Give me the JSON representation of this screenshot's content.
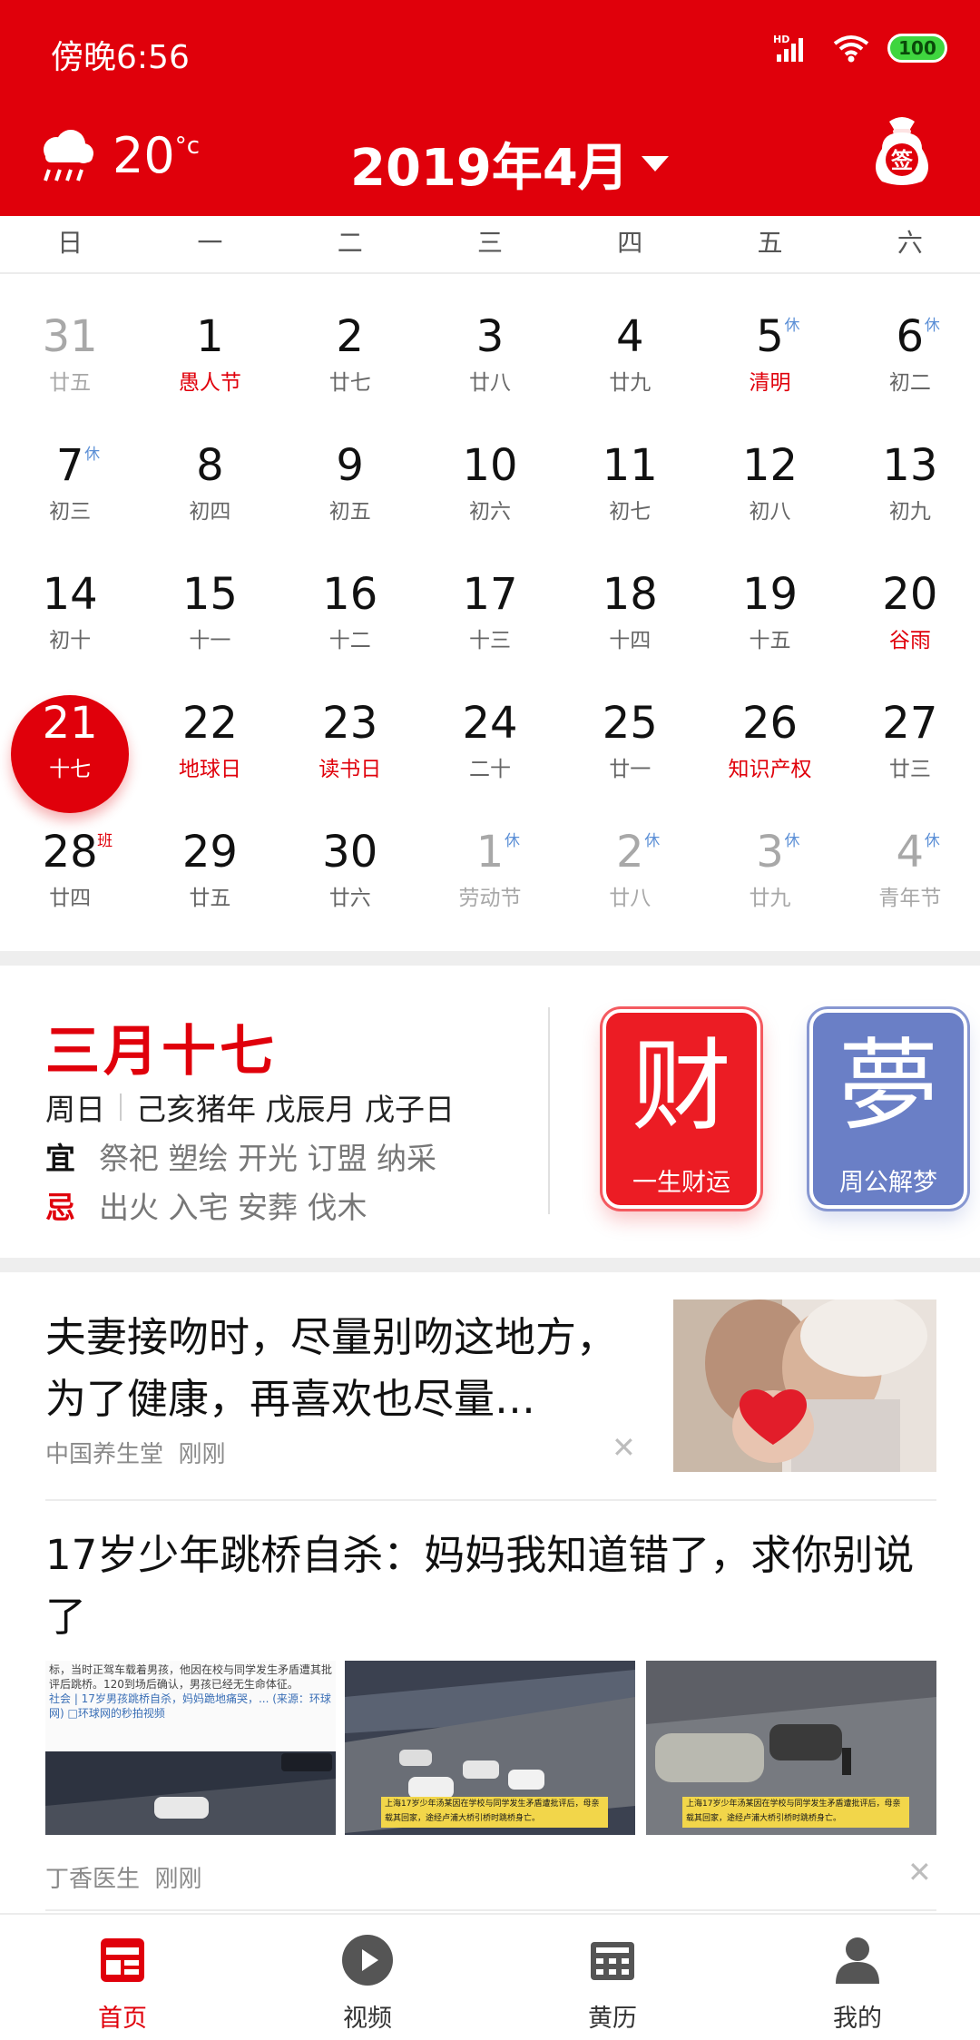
{
  "status_bar": {
    "time": "傍晚6:56",
    "network": "HD",
    "battery": "100"
  },
  "header": {
    "temperature": "20",
    "temp_unit": "°c",
    "month": "2019年4月",
    "sign_label": "签"
  },
  "weekdays": [
    "日",
    "一",
    "二",
    "三",
    "四",
    "五",
    "六"
  ],
  "calendar": {
    "rows": [
      [
        {
          "d": "31",
          "l": "廿五",
          "muted": true
        },
        {
          "d": "1",
          "l": "愚人节",
          "red": true
        },
        {
          "d": "2",
          "l": "廿七"
        },
        {
          "d": "3",
          "l": "廿八"
        },
        {
          "d": "4",
          "l": "廿九"
        },
        {
          "d": "5",
          "l": "清明",
          "red": true,
          "tag": "休"
        },
        {
          "d": "6",
          "l": "初二",
          "tag": "休"
        }
      ],
      [
        {
          "d": "7",
          "l": "初三",
          "tag": "休"
        },
        {
          "d": "8",
          "l": "初四"
        },
        {
          "d": "9",
          "l": "初五"
        },
        {
          "d": "10",
          "l": "初六"
        },
        {
          "d": "11",
          "l": "初七"
        },
        {
          "d": "12",
          "l": "初八"
        },
        {
          "d": "13",
          "l": "初九"
        }
      ],
      [
        {
          "d": "14",
          "l": "初十"
        },
        {
          "d": "15",
          "l": "十一"
        },
        {
          "d": "16",
          "l": "十二"
        },
        {
          "d": "17",
          "l": "十三"
        },
        {
          "d": "18",
          "l": "十四"
        },
        {
          "d": "19",
          "l": "十五"
        },
        {
          "d": "20",
          "l": "谷雨",
          "red": true
        }
      ],
      [
        {
          "d": "21",
          "l": "十七",
          "today": true
        },
        {
          "d": "22",
          "l": "地球日",
          "red": true
        },
        {
          "d": "23",
          "l": "读书日",
          "red": true
        },
        {
          "d": "24",
          "l": "二十"
        },
        {
          "d": "25",
          "l": "廿一"
        },
        {
          "d": "26",
          "l": "知识产权",
          "red": true
        },
        {
          "d": "27",
          "l": "廿三"
        }
      ],
      [
        {
          "d": "28",
          "l": "廿四",
          "tag": "班",
          "ban": true
        },
        {
          "d": "29",
          "l": "廿五"
        },
        {
          "d": "30",
          "l": "廿六"
        },
        {
          "d": "1",
          "l": "劳动节",
          "muted": true,
          "tag": "休"
        },
        {
          "d": "2",
          "l": "廿八",
          "muted": true,
          "tag": "休"
        },
        {
          "d": "3",
          "l": "廿九",
          "muted": true,
          "tag": "休"
        },
        {
          "d": "4",
          "l": "青年节",
          "muted": true,
          "tag": "休"
        }
      ]
    ]
  },
  "almanac": {
    "lunar_date": "三月十七",
    "weekday": "周日",
    "ganzhi": "己亥猪年 戊辰月 戊子日",
    "yi_label": "宜",
    "yi": "祭祀 塑绘 开光 订盟 纳采",
    "ji_label": "忌",
    "ji": "出火 入宅 安葬 伐木",
    "card1_char": "财",
    "card1_caption": "一生财运",
    "card2_char": "夢",
    "card2_caption": "周公解梦"
  },
  "news": [
    {
      "title": "夫妻接吻时，尽量别吻这地方，为了健康，再喜欢也尽量…",
      "source": "中国养生堂",
      "time": "刚刚"
    },
    {
      "title": "17岁少年跳桥自杀：妈妈我知道错了，求你别说了",
      "source": "丁香医生",
      "time": "刚刚",
      "thumb1_text": "标，当时正驾车载着男孩，他因在校与同学发生矛盾遭其批评后跳桥。120到场后确认，男孩已经无生命体征。",
      "thumb1_link": "社会 | 17岁男孩跳桥自杀，妈妈跪地痛哭，... (来源：环球网) □环球网的秒拍视频",
      "thumb_caption": "上海17岁少年汤某因在学校与同学发生矛盾遭批评后，母亲载其回家，途经卢浦大桥引桥时跳桥身亡。"
    }
  ],
  "nav": [
    {
      "label": "首页",
      "active": true
    },
    {
      "label": "视频"
    },
    {
      "label": "黄历"
    },
    {
      "label": "我的"
    }
  ],
  "colors": {
    "brand_red": "#e0000b",
    "holiday_blue": "#5b8fd6"
  }
}
